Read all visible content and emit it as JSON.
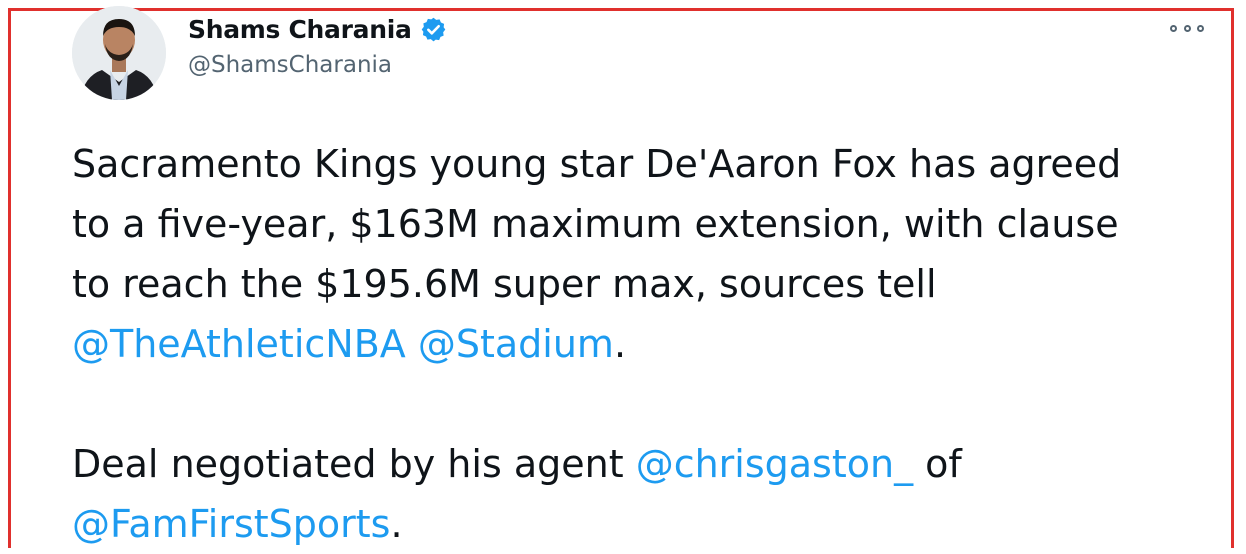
{
  "author": {
    "display_name": "Shams Charania",
    "handle": "@ShamsCharania",
    "verified": true
  },
  "menu": {
    "icon": "more-options-icon"
  },
  "tweet": {
    "line1": "Sacramento Kings young star De'Aaron Fox has agreed",
    "line2": "to a five-year, $163M maximum extension, with clause",
    "line3": "to reach the $195.6M super max, sources tell",
    "mention_athletic": "@TheAthleticNBA",
    "mention_stadium": "@Stadium",
    "period1": ".",
    "line5_text": "Deal negotiated by his agent ",
    "mention_agent": "@chrisgaston_",
    "line5_of": " of",
    "mention_famfirst": "@FamFirstSports",
    "period2": "."
  },
  "colors": {
    "link": "#1d9bf0",
    "text": "#0f1419",
    "secondary": "#536471",
    "verified": "#1d9bf0",
    "frame": "#e0302d"
  }
}
